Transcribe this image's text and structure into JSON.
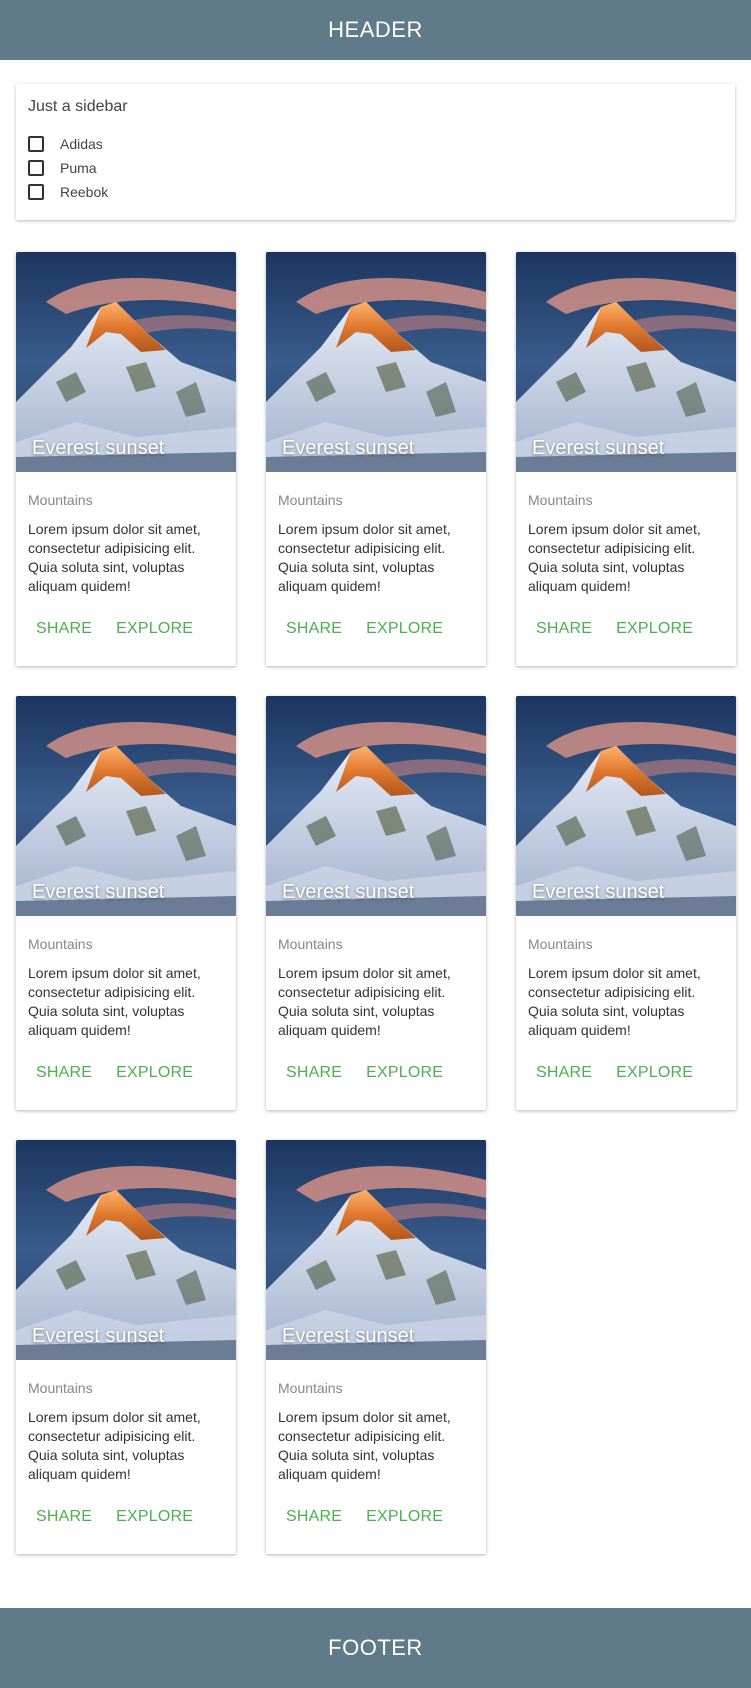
{
  "header": {
    "title": "HEADER"
  },
  "sidebar": {
    "title": "Just a sidebar",
    "filters": [
      {
        "label": "Adidas",
        "checked": false
      },
      {
        "label": "Puma",
        "checked": false
      },
      {
        "label": "Reebok",
        "checked": false
      }
    ]
  },
  "cards": [
    {
      "image_caption": "Everest sunset",
      "subtitle": "Mountains",
      "text": "Lorem ipsum dolor sit amet, consectetur adipisicing elit. Quia soluta sint, voluptas aliquam quidem!",
      "actions": [
        "SHARE",
        "EXPLORE"
      ]
    },
    {
      "image_caption": "Everest sunset",
      "subtitle": "Mountains",
      "text": "Lorem ipsum dolor sit amet, consectetur adipisicing elit. Quia soluta sint, voluptas aliquam quidem!",
      "actions": [
        "SHARE",
        "EXPLORE"
      ]
    },
    {
      "image_caption": "Everest sunset",
      "subtitle": "Mountains",
      "text": "Lorem ipsum dolor sit amet, consectetur adipisicing elit. Quia soluta sint, voluptas aliquam quidem!",
      "actions": [
        "SHARE",
        "EXPLORE"
      ]
    },
    {
      "image_caption": "Everest sunset",
      "subtitle": "Mountains",
      "text": "Lorem ipsum dolor sit amet, consectetur adipisicing elit. Quia soluta sint, voluptas aliquam quidem!",
      "actions": [
        "SHARE",
        "EXPLORE"
      ]
    },
    {
      "image_caption": "Everest sunset",
      "subtitle": "Mountains",
      "text": "Lorem ipsum dolor sit amet, consectetur adipisicing elit. Quia soluta sint, voluptas aliquam quidem!",
      "actions": [
        "SHARE",
        "EXPLORE"
      ]
    },
    {
      "image_caption": "Everest sunset",
      "subtitle": "Mountains",
      "text": "Lorem ipsum dolor sit amet, consectetur adipisicing elit. Quia soluta sint, voluptas aliquam quidem!",
      "actions": [
        "SHARE",
        "EXPLORE"
      ]
    },
    {
      "image_caption": "Everest sunset",
      "subtitle": "Mountains",
      "text": "Lorem ipsum dolor sit amet, consectetur adipisicing elit. Quia soluta sint, voluptas aliquam quidem!",
      "actions": [
        "SHARE",
        "EXPLORE"
      ]
    },
    {
      "image_caption": "Everest sunset",
      "subtitle": "Mountains",
      "text": "Lorem ipsum dolor sit amet, consectetur adipisicing elit. Quia soluta sint, voluptas aliquam quidem!",
      "actions": [
        "SHARE",
        "EXPLORE"
      ]
    }
  ],
  "footer": {
    "title": "FOOTER"
  },
  "colors": {
    "bar": "#5f7a89",
    "action": "#4caf50",
    "subtitle": "#888888"
  }
}
